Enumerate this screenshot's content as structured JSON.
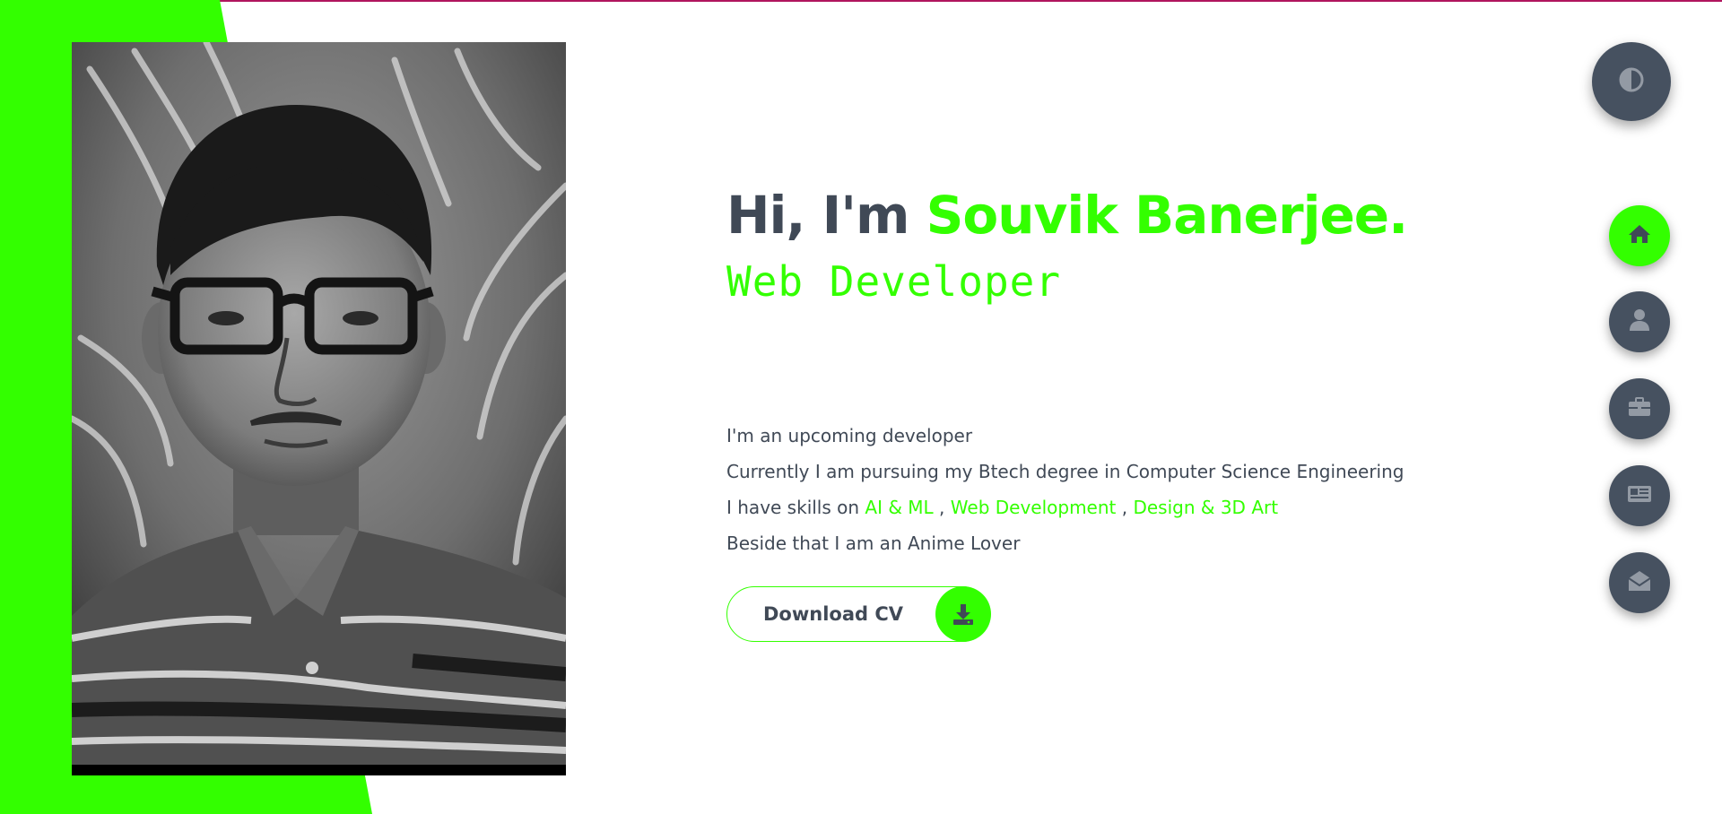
{
  "hero": {
    "greeting_prefix": "Hi, I'm ",
    "name": "Souvik Banerjee.",
    "role": "Web Developer"
  },
  "bio": {
    "line1": "I'm an upcoming developer",
    "line2": "Currently I am pursuing my Btech degree in Computer Science Engineering",
    "line3_prefix": "I have skills on ",
    "skills": [
      "AI & ML",
      "Web Development",
      "Design & 3D Art"
    ],
    "skill_separator": " , ",
    "line4": "Beside that I am an Anime Lover"
  },
  "cv_button": {
    "label": "Download CV",
    "icon": "download-icon"
  },
  "theme_toggle": {
    "icon": "contrast-icon"
  },
  "nav": [
    {
      "name": "home",
      "icon": "home-icon",
      "active": true
    },
    {
      "name": "about",
      "icon": "user-icon",
      "active": false
    },
    {
      "name": "portfolio",
      "icon": "briefcase-icon",
      "active": false
    },
    {
      "name": "blog",
      "icon": "newspaper-icon",
      "active": false
    },
    {
      "name": "contact",
      "icon": "envelope-open-icon",
      "active": false
    }
  ],
  "colors": {
    "accent": "#33ff00",
    "text": "#404956",
    "button_dark": "#465160",
    "top_line": "#b0155e"
  }
}
